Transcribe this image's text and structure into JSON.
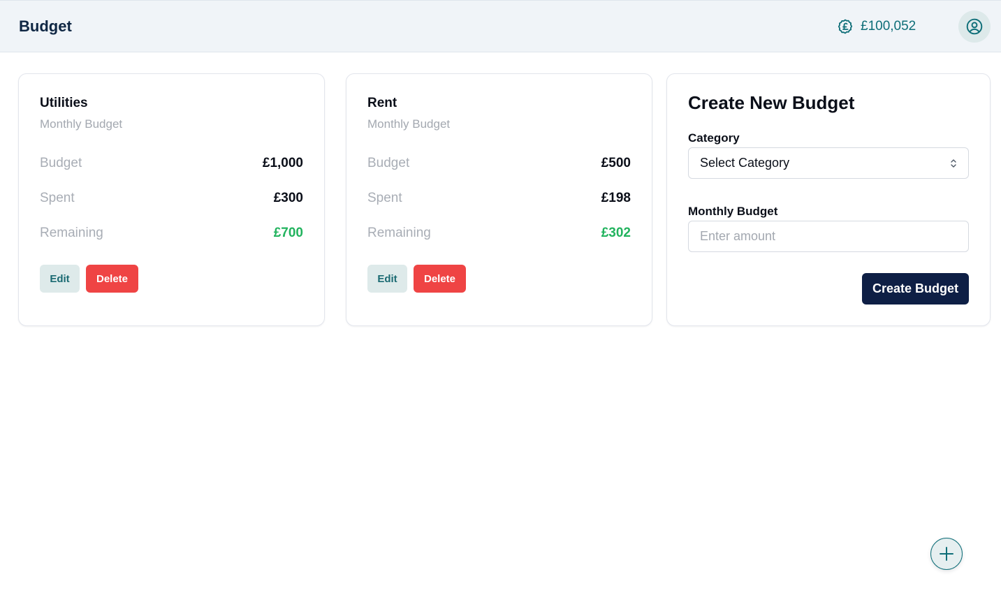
{
  "header": {
    "title": "Budget",
    "balance": "£100,052",
    "balance_icon": "pound-coin-icon",
    "profile_icon": "user-circle-icon"
  },
  "budgets": [
    {
      "category": "Utilities",
      "subtitle": "Monthly Budget",
      "budget_label": "Budget",
      "budget_value": "£1,000",
      "spent_label": "Spent",
      "spent_value": "£300",
      "remaining_label": "Remaining",
      "remaining_value": "£700",
      "edit_label": "Edit",
      "delete_label": "Delete"
    },
    {
      "category": "Rent",
      "subtitle": "Monthly Budget",
      "budget_label": "Budget",
      "budget_value": "£500",
      "spent_label": "Spent",
      "spent_value": "£198",
      "remaining_label": "Remaining",
      "remaining_value": "£302",
      "edit_label": "Edit",
      "delete_label": "Delete"
    }
  ],
  "create_form": {
    "title": "Create New Budget",
    "category_label": "Category",
    "category_selected": "Select Category",
    "amount_label": "Monthly Budget",
    "amount_placeholder": "Enter amount",
    "amount_value": "",
    "submit_label": "Create Budget"
  },
  "fab": {
    "icon": "plus-icon"
  },
  "colors": {
    "accent": "#0e6e78",
    "primary_button": "#0e1f45",
    "danger": "#ef4444",
    "positive": "#22b35e",
    "header_bg": "#f0f4f8"
  }
}
